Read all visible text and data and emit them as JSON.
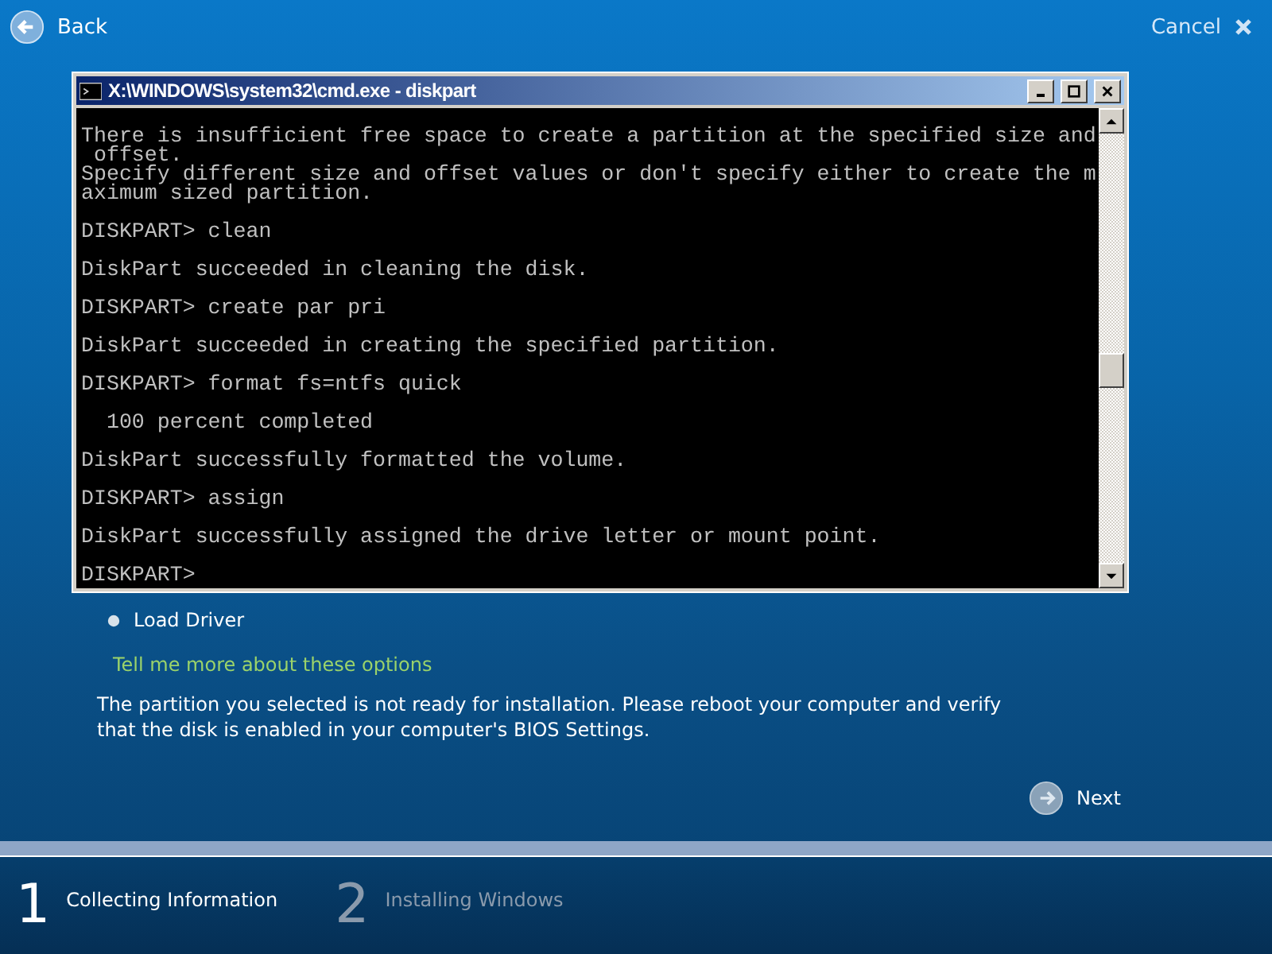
{
  "header": {
    "back": "Back",
    "cancel": "Cancel"
  },
  "console": {
    "title": "X:\\WINDOWS\\system32\\cmd.exe - diskpart",
    "blocks": [
      [
        "There is insufficient free space to create a partition at the specified size and",
        " offset.",
        "Specify different size and offset values or don't specify either to create the m",
        "aximum sized partition."
      ],
      [
        "DISKPART> clean"
      ],
      [
        "DiskPart succeeded in cleaning the disk."
      ],
      [
        "DISKPART> create par pri"
      ],
      [
        "DiskPart succeeded in creating the specified partition."
      ],
      [
        "DISKPART> format fs=ntfs quick"
      ],
      [
        "  100 percent completed"
      ],
      [
        "DiskPart successfully formatted the volume."
      ],
      [
        "DISKPART> assign"
      ],
      [
        "DiskPart successfully assigned the drive letter or mount point."
      ],
      [
        "DISKPART>"
      ]
    ]
  },
  "load_driver": "Load Driver",
  "help_link": "Tell me more about these options",
  "message": "The partition you selected is not ready for installation. Please reboot your computer and verify that the disk is enabled in your computer's BIOS Settings.",
  "next": "Next",
  "progress": {
    "level": 1
  },
  "steps": [
    {
      "number": "1",
      "label": "Collecting Information",
      "selected": true
    },
    {
      "number": "2",
      "label": "Installing Windows",
      "selected": false
    }
  ]
}
